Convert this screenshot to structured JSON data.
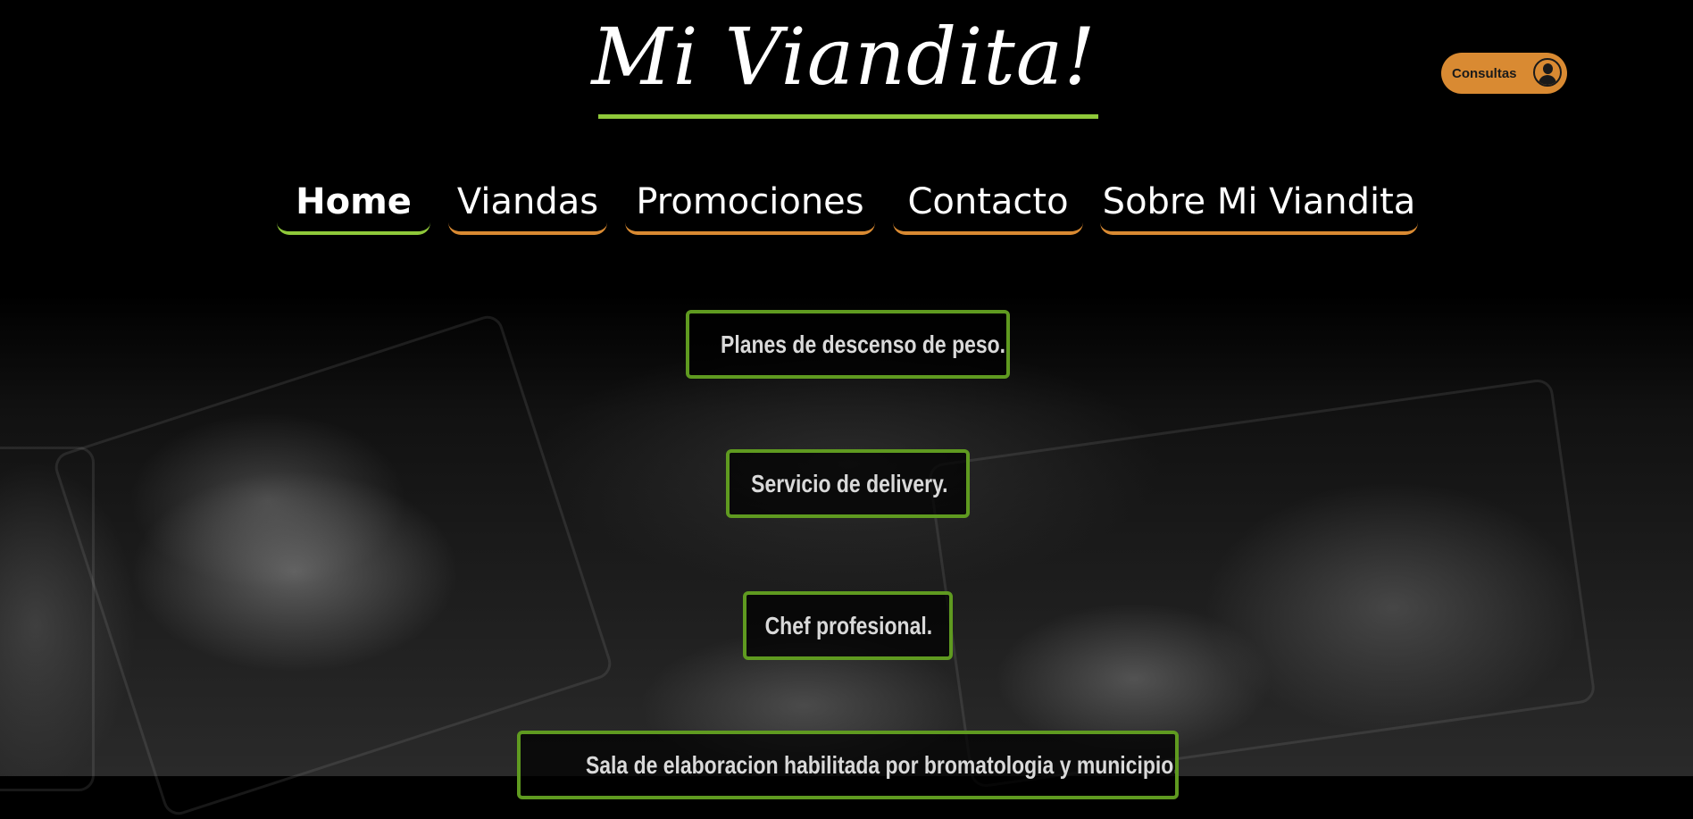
{
  "header": {
    "logo_text": "Mi Viandita!",
    "consultas_label": "Consultas",
    "consultas_icon": "user-icon",
    "accent_green": "#8fc93a",
    "accent_orange": "#d98a32"
  },
  "nav": {
    "items": [
      {
        "label": "Home",
        "active": true
      },
      {
        "label": "Viandas",
        "active": false
      },
      {
        "label": "Promociones",
        "active": false
      },
      {
        "label": "Contacto",
        "active": false
      },
      {
        "label": "Sobre Mi Viandita",
        "active": false
      }
    ]
  },
  "features": [
    "Planes de descenso de peso.",
    "Servicio de delivery.",
    "Chef profesional.",
    "Sala de elaboracion habilitada por bromatologia y municipio."
  ]
}
